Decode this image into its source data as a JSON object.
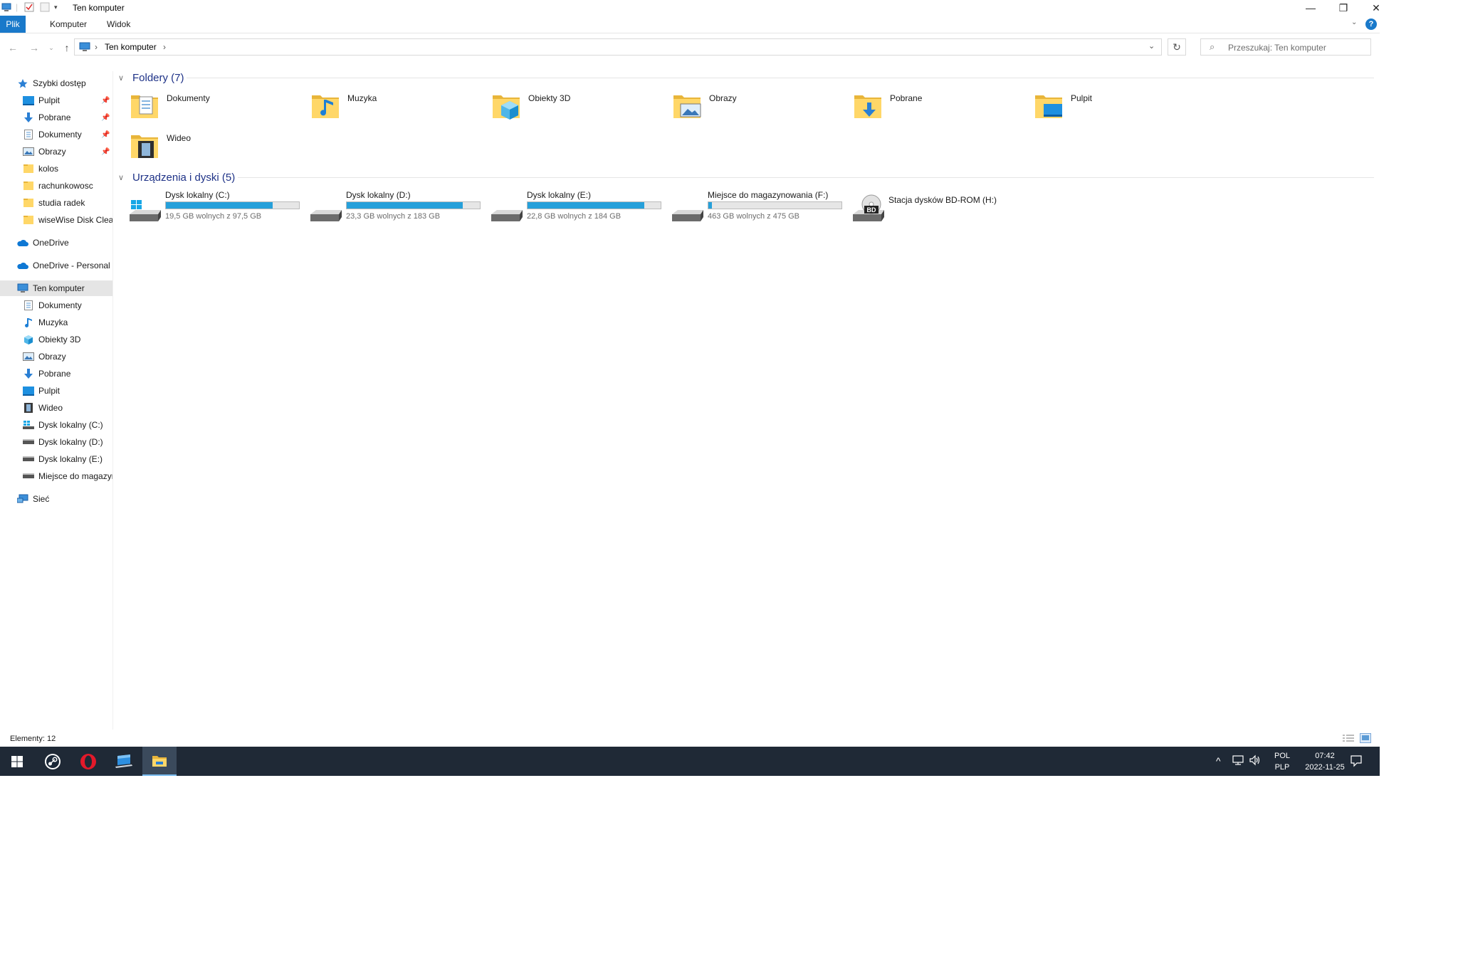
{
  "window": {
    "title": "Ten komputer",
    "controls": {
      "minimize": "—",
      "maximize": "❐",
      "close": "✕"
    }
  },
  "ribbon": {
    "tabs": [
      "Plik",
      "Komputer",
      "Widok"
    ],
    "help_label": "?"
  },
  "address": {
    "path": "Ten komputer",
    "separator": "›",
    "search_placeholder": "Przeszukaj: Ten komputer"
  },
  "sidebar": {
    "quick_access": "Szybki dostęp",
    "quick_items": [
      "Pulpit",
      "Pobrane",
      "Dokumenty",
      "Obrazy",
      "kolos",
      "rachunkowosc",
      "studia radek",
      "wiseWise Disk Cleaner"
    ],
    "onedrive": "OneDrive",
    "onedrive_personal": "OneDrive - Personal",
    "this_pc": "Ten komputer",
    "pc_items": [
      "Dokumenty",
      "Muzyka",
      "Obiekty 3D",
      "Obrazy",
      "Pobrane",
      "Pulpit",
      "Wideo",
      "Dysk lokalny (C:)",
      "Dysk lokalny (D:)",
      "Dysk lokalny (E:)",
      "Miejsce do magazynowania (F:)"
    ],
    "network": "Sieć"
  },
  "folders": {
    "header": "Foldery (7)",
    "items": [
      "Dokumenty",
      "Muzyka",
      "Obiekty 3D",
      "Obrazy",
      "Pobrane",
      "Pulpit",
      "Wideo"
    ]
  },
  "devices": {
    "header": "Urządzenia i dyski (5)",
    "items": [
      {
        "name": "Dysk lokalny (C:)",
        "free": "19,5 GB wolnych z 97,5 GB",
        "used_fraction": 0.8
      },
      {
        "name": "Dysk lokalny (D:)",
        "free": "23,3 GB wolnych z 183 GB",
        "used_fraction": 0.873
      },
      {
        "name": "Dysk lokalny (E:)",
        "free": "22,8 GB wolnych z 184 GB",
        "used_fraction": 0.876
      },
      {
        "name": "Miejsce do magazynowania (F:)",
        "free": "463 GB wolnych z 475 GB",
        "used_fraction": 0.025
      },
      {
        "name": "Stacja dysków BD-ROM (H:)"
      }
    ]
  },
  "status": {
    "items": "Elementy: 12"
  },
  "taskbar": {
    "lang": "POL",
    "layout": "PLP",
    "time": "07:42",
    "date": "2022-11-25"
  },
  "colors": {
    "accent": "#1979ca",
    "bar": "#26a0da",
    "taskbar": "#1f2936",
    "group": "#1e3287"
  }
}
